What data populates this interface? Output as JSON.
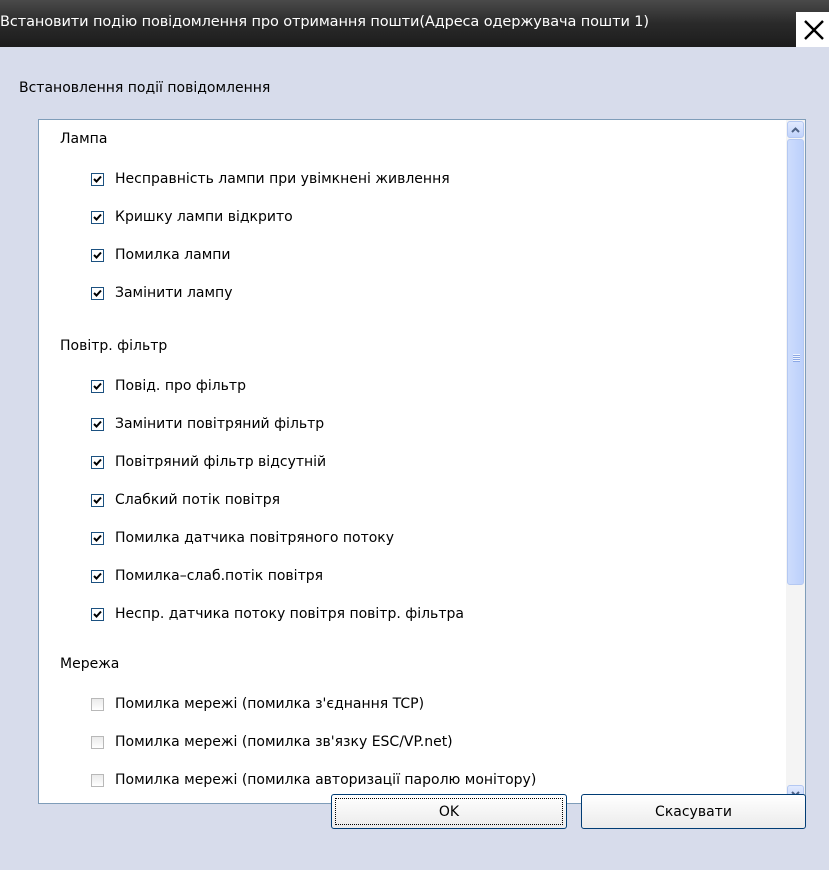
{
  "window": {
    "title": "Встановити подію повідомлення про отримання пошти(Адреса одержувача пошти 1)"
  },
  "section_label": "Встановлення події повідомлення",
  "groups": [
    {
      "label": "Лампа",
      "items": [
        {
          "label": "Несправність лампи при увімкнені живлення",
          "checked": true
        },
        {
          "label": "Кришку лампи відкрито",
          "checked": true
        },
        {
          "label": "Помилка лампи",
          "checked": true
        },
        {
          "label": "Замінити лампу",
          "checked": true
        }
      ]
    },
    {
      "label": "Повітр. фільтр",
      "items": [
        {
          "label": "Повід. про фільтр",
          "checked": true
        },
        {
          "label": "Замінити повітряний фільтр",
          "checked": true
        },
        {
          "label": "Повітряний фільтр відсутній",
          "checked": true
        },
        {
          "label": "Слабкий потік повітря",
          "checked": true
        },
        {
          "label": "Помилка датчика повітряного потоку",
          "checked": true
        },
        {
          "label": "Помилка–слаб.потік повітря",
          "checked": true
        },
        {
          "label": "Неспр. датчика потоку повітря повітр. фільтра",
          "checked": true
        }
      ]
    },
    {
      "label": "Мережа",
      "items": [
        {
          "label": "Помилка мережі (помилка з'єднання TCP)",
          "checked": false
        },
        {
          "label": "Помилка мережі (помилка зв'язку ESC/VP.net)",
          "checked": false
        },
        {
          "label": "Помилка мережі (помилка авторизації паролю монітору)",
          "checked": false
        }
      ]
    }
  ],
  "buttons": {
    "ok": "OK",
    "cancel": "Скасувати"
  }
}
